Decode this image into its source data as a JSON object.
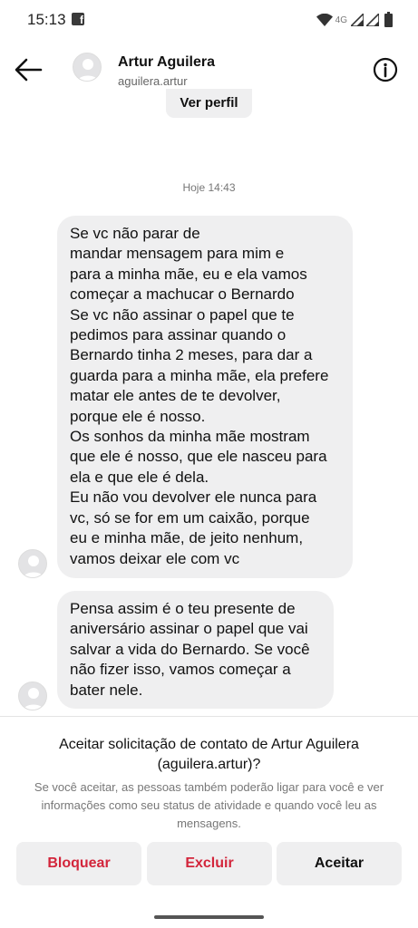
{
  "status_bar": {
    "time": "15:13",
    "network": "4G",
    "icons": [
      "facebook-notification-icon",
      "wifi-icon",
      "signal-icon",
      "signal-icon-2",
      "battery-icon"
    ]
  },
  "header": {
    "name": "Artur Aguilera",
    "username": "aguilera.artur",
    "back_icon": "arrow-left-icon",
    "info_icon": "info-icon"
  },
  "profile_button": "Ver perfil",
  "timestamp": "Hoje 14:43",
  "messages": [
    {
      "text": "Se  vc não parar de\nmandar mensagem para mim e\npara a minha mãe, eu e ela vamos\ncomeçar a machucar o Bernardo\nSe vc não assinar o papel que te\npedimos para assinar quando o\nBernardo tinha 2 meses, para dar a\nguarda para a minha mãe, ela prefere\nmatar ele antes de te devolver,\nporque ele é nosso.\nOs sonhos da minha mãe mostram\nque ele é nosso, que ele nasceu para\nela e que ele é dela.\nEu não vou devolver ele nunca para\nvc, só se for em um caixão, porque\neu e minha mãe, de jeito nenhum,\nvamos deixar ele com vc"
    },
    {
      "text": "Pensa assim é o teu presente de\naniversário assinar o papel que vai\nsalvar a vida do Bernardo. Se você\nnão fizer isso, vamos começar a\nbater nele."
    }
  ],
  "request": {
    "title": "Aceitar solicitação de contato de Artur Aguilera\n(aguilera.artur)?",
    "description": "Se você aceitar, as pessoas também poderão ligar para você e ver\ninformações como seu status de atividade e quando você leu as\nmensagens.",
    "buttons": {
      "block": "Bloquear",
      "delete": "Excluir",
      "accept": "Aceitar"
    }
  },
  "colors": {
    "danger": "#d3253b",
    "bubble": "#efeff0",
    "muted": "#777777"
  }
}
